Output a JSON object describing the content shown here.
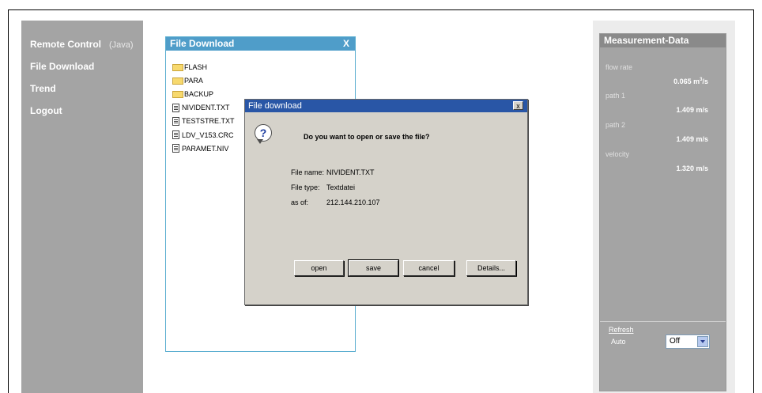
{
  "nav": {
    "remote_control": "Remote Control",
    "remote_control_sub": "(Java)",
    "file_download": "File Download",
    "trend": "Trend",
    "logout": "Logout"
  },
  "file_panel": {
    "title": "File Download",
    "close": "X",
    "files": [
      {
        "name": "FLASH",
        "type": "folder"
      },
      {
        "name": "PARA",
        "type": "folder"
      },
      {
        "name": "BACKUP",
        "type": "folder"
      },
      {
        "name": "NIVIDENT.TXT",
        "type": "file"
      },
      {
        "name": "TESTSTRE.TXT",
        "type": "file"
      },
      {
        "name": "LDV_V153.CRC",
        "type": "file"
      },
      {
        "name": "PARAMET.NIV",
        "type": "file"
      }
    ]
  },
  "dialog": {
    "title": "File download",
    "close": "x",
    "question": "Do you want to open or save the file?",
    "file_name_label": "File name:",
    "file_name": "NIVIDENT.TXT",
    "file_type_label": "File type:",
    "file_type": "Textdatei",
    "as_of_label": "as of:",
    "as_of": "212.144.210.107",
    "buttons": {
      "open": "open",
      "save": "save",
      "cancel": "cancel",
      "details": "Details..."
    }
  },
  "measurement": {
    "title": "Measurement-Data",
    "flow_rate_label": "flow rate",
    "flow_rate_value": "0.065 m",
    "flow_rate_unit_sup": "3",
    "flow_rate_unit_tail": "/s",
    "path1_label": "path 1",
    "path1_value": "1.409 m/s",
    "path2_label": "path 2",
    "path2_value": "1.409 m/s",
    "velocity_label": "velocity",
    "velocity_value": "1.320 m/s",
    "refresh": "Refresh",
    "auto_label": "Auto",
    "auto_value": "Off"
  },
  "colors": {
    "nav_bg": "#a4a4a4",
    "panel_title": "#4f9dc9",
    "dialog_title": "#2956a6",
    "dialog_bg": "#d5d2ca"
  }
}
